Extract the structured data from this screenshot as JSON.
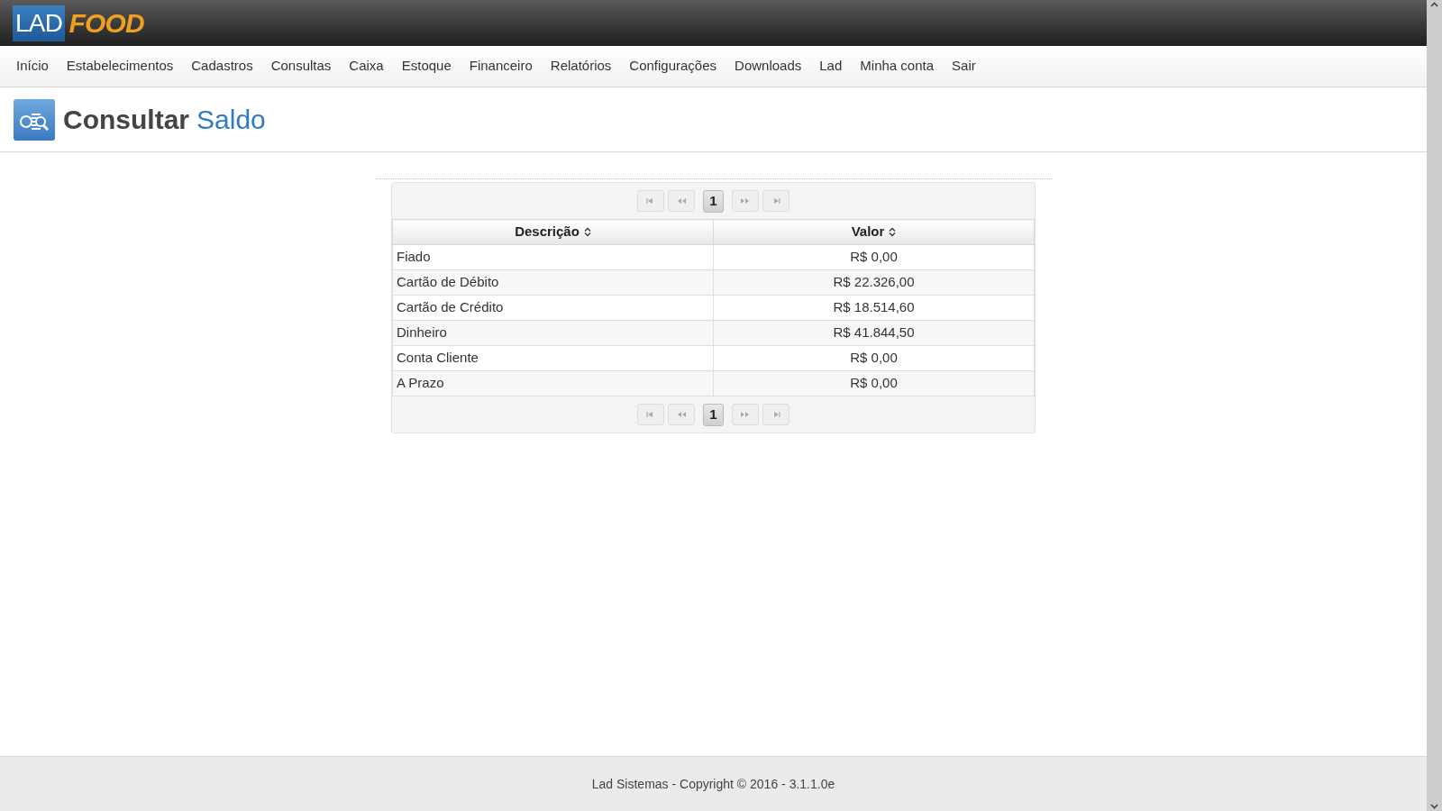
{
  "logo": {
    "part_1": "LAD",
    "part_2": "FOOD"
  },
  "nav": [
    {
      "label": "Início"
    },
    {
      "label": "Estabelecimentos"
    },
    {
      "label": "Cadastros"
    },
    {
      "label": "Consultas"
    },
    {
      "label": "Caixa"
    },
    {
      "label": "Estoque"
    },
    {
      "label": "Financeiro"
    },
    {
      "label": "Relatórios"
    },
    {
      "label": "Configurações"
    },
    {
      "label": "Downloads"
    },
    {
      "label": "Lad"
    },
    {
      "label": "Minha conta"
    },
    {
      "label": "Sair"
    }
  ],
  "page_title": {
    "verb": "Consultar",
    "subject": "Saldo"
  },
  "pager_top": {
    "pages": [
      {
        "label": "1",
        "selected": true
      }
    ]
  },
  "table": {
    "columns": [
      {
        "label": "Descrição",
        "sortable": true
      },
      {
        "label": "Valor",
        "sortable": true
      }
    ],
    "rows": [
      [
        "Fiado",
        "R$ 0,00"
      ],
      [
        "Cartão de Débito",
        "R$ 22.326,00"
      ],
      [
        "Cartão de Crédito",
        "R$ 18.514,60"
      ],
      [
        "Dinheiro",
        "R$ 41.844,50"
      ],
      [
        "Conta Cliente",
        "R$ 0,00"
      ],
      [
        "A Prazo",
        "R$ 0,00"
      ]
    ]
  },
  "pager_bottom": {
    "pages": [
      {
        "label": "1",
        "selected": true
      }
    ]
  },
  "footer": "Lad Sistemas - Copyright © 2016 - 3.1.1.0e"
}
